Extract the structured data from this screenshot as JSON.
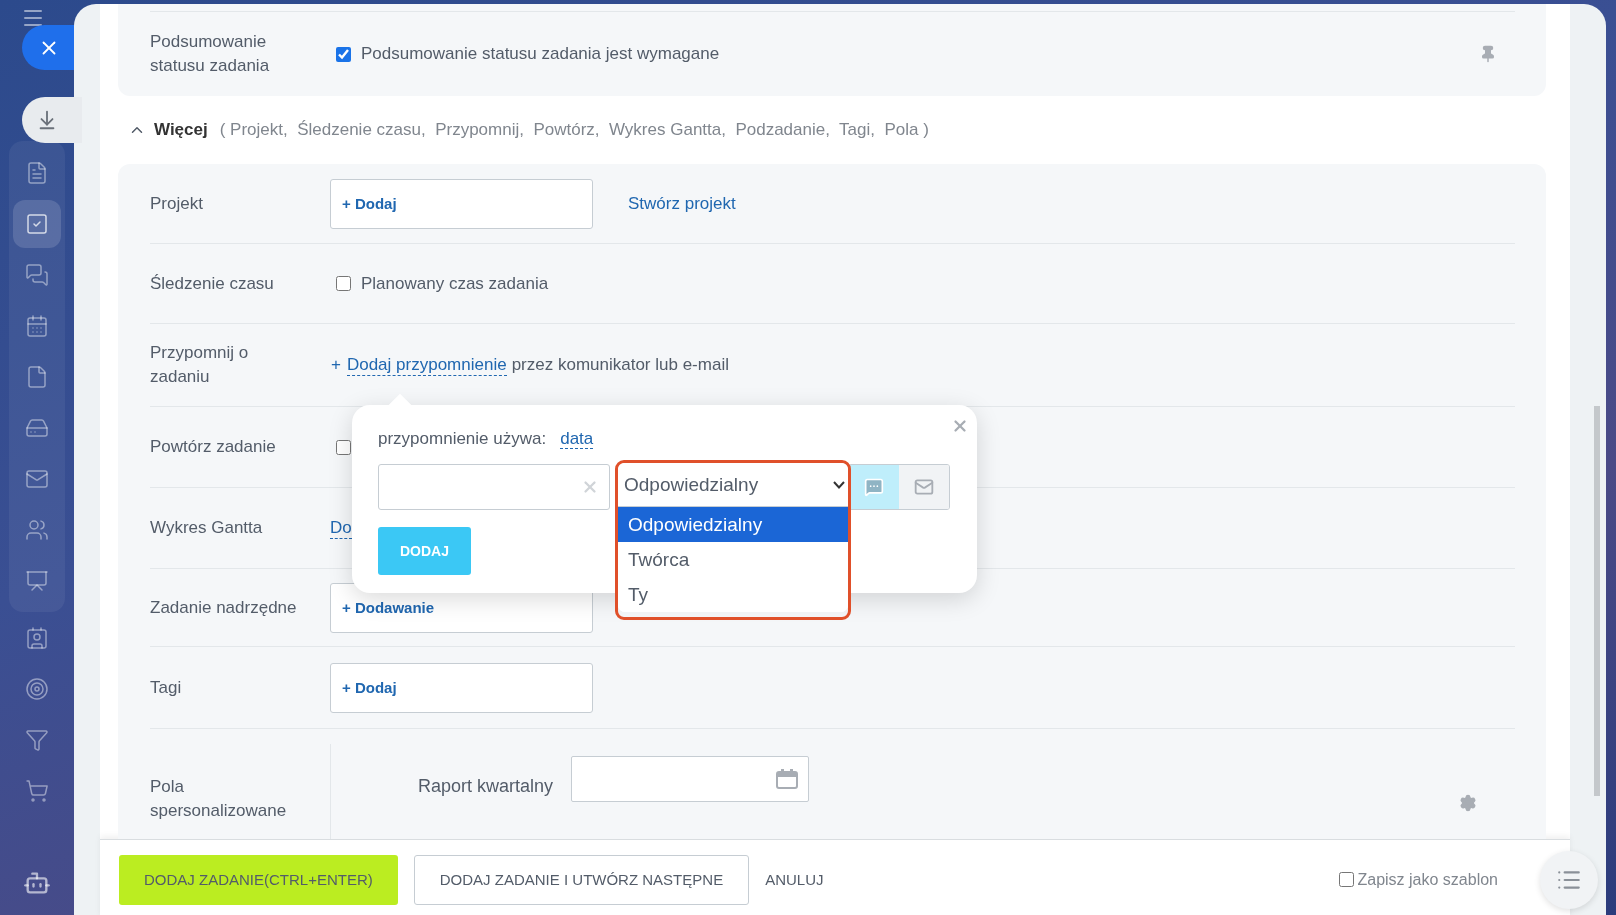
{
  "sidebar": {
    "items": [
      {
        "selected": false
      },
      {
        "selected": true
      },
      {
        "selected": false
      },
      {
        "selected": false
      },
      {
        "selected": false
      },
      {
        "selected": false
      },
      {
        "selected": false
      },
      {
        "selected": false
      },
      {
        "selected": false
      },
      {
        "selected": false
      },
      {
        "selected": false
      },
      {
        "selected": false
      },
      {
        "selected": false
      }
    ]
  },
  "summary": {
    "label": "Podsumowanie\nstatusu zadania",
    "checkbox_label": "Podsumowanie statusu zadania jest wymagane",
    "checked": true
  },
  "more": {
    "title": "Więcej",
    "expanded": true,
    "list": "( Projekt,  Śledzenie czasu,  Przypomnij,  Powtórz,  Wykres Gantta,  Podzadanie,  Tagi,  Pola )"
  },
  "rows": [
    {
      "kind": "button",
      "label": "Projekt",
      "button": "+ Dodaj",
      "link": "Stwórz projekt"
    },
    {
      "kind": "checkbox",
      "label": "Śledzenie czasu",
      "checkbox_label": "Planowany czas zadania",
      "checked": false
    },
    {
      "kind": "reminder",
      "label": "Przypomnij o\nzadaniu",
      "plus": "+",
      "link": "Dodaj przypomnienie",
      "text": "przez komunikator lub e-mail"
    },
    {
      "kind": "checkbox",
      "label": "Powtórz zadanie",
      "checked": false
    },
    {
      "kind": "link",
      "label": "Wykres Gantta",
      "link": "Do"
    },
    {
      "kind": "button",
      "label": "Zadanie nadrzędne",
      "button": "+ Dodawanie"
    },
    {
      "kind": "button",
      "label": "Tagi",
      "button": "+ Dodaj"
    },
    {
      "kind": "custom",
      "label": "Pola\nspersonalizowane",
      "field_label": "Raport kwartalny"
    }
  ],
  "popup": {
    "label": "przypomnienie używa:",
    "link": "data",
    "recipient": {
      "value": "Odpowiedzialny",
      "options": [
        {
          "label": "Odpowiedzialny",
          "selected": true
        },
        {
          "label": "Twórca",
          "selected": false
        },
        {
          "label": "Ty",
          "selected": false
        }
      ]
    },
    "channels": [
      {
        "kind": "chat",
        "selected": true
      },
      {
        "kind": "mail",
        "selected": false
      }
    ],
    "button": "DODAJ"
  },
  "footer": {
    "buttons": [
      {
        "kind": "primary",
        "label": "DODAJ ZADANIE(CTRL+ENTER)"
      },
      {
        "kind": "outline",
        "label": "DODAJ ZADANIE I UTWÓRZ NASTĘPNE"
      },
      {
        "kind": "link",
        "label": "ANULUJ"
      }
    ],
    "template": {
      "label": "Zapisz jako szablon",
      "checked": false
    }
  }
}
